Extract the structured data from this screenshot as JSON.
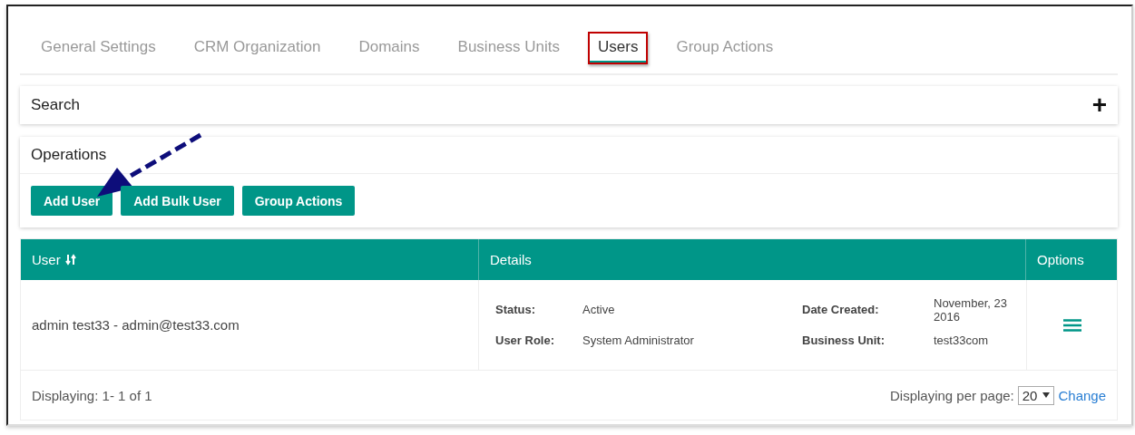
{
  "tabs": [
    {
      "label": "General Settings",
      "selected": false,
      "highlighted": false
    },
    {
      "label": "CRM Organization",
      "selected": false,
      "highlighted": false
    },
    {
      "label": "Domains",
      "selected": false,
      "highlighted": false
    },
    {
      "label": "Business Units",
      "selected": false,
      "highlighted": false
    },
    {
      "label": "Users",
      "selected": true,
      "highlighted": true
    },
    {
      "label": "Group Actions",
      "selected": false,
      "highlighted": false
    }
  ],
  "search": {
    "title": "Search",
    "expand_icon": "+"
  },
  "operations": {
    "title": "Operations",
    "buttons": [
      {
        "label": "Add User",
        "pointed": true
      },
      {
        "label": "Add Bulk User",
        "pointed": false
      },
      {
        "label": "Group Actions",
        "pointed": false
      }
    ]
  },
  "table": {
    "columns": [
      "User",
      "Details",
      "Options"
    ],
    "rows": [
      {
        "user": "admin test33 - admin@test33.com",
        "details": [
          {
            "label": "Status:",
            "value": "Active"
          },
          {
            "label": "User Role:",
            "value": "System Administrator"
          },
          {
            "label": "Date Created:",
            "value": "November, 23 2016"
          },
          {
            "label": "Business Unit:",
            "value": "test33com"
          }
        ]
      }
    ],
    "footer": {
      "displaying": "Displaying: 1- 1 of 1",
      "per_page_label": "Displaying per page:",
      "per_page": "20",
      "change_link": "Change"
    }
  }
}
